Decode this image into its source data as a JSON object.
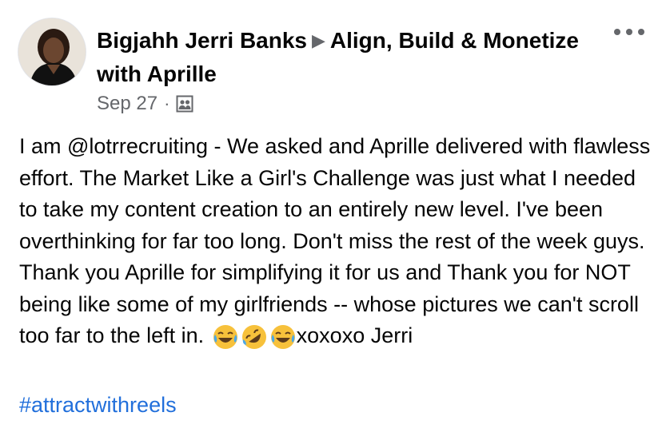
{
  "post": {
    "author": "Bigjahh Jerri Banks",
    "arrow": "▶",
    "group": "Align, Build & Monetize with Aprille",
    "date": "Sep 27",
    "dot": "·",
    "privacy_icon": "group-members-icon",
    "more_icon": "more-options-icon",
    "text_main": "I am @lotrrecruiting - We asked and Aprille delivered with flawless effort. The Market Like a Girl's Challenge was just what I needed to take my content creation to an entirely new level. I've been overthinking for far too long. Don't miss the rest of the week guys. Thank you Aprille for simplifying it for us and Thank you for NOT being like some of my girlfriends -- whose pictures we can't scroll too far to the left in.",
    "emojis": [
      "face-with-tears-of-joy-icon",
      "rolling-on-floor-laughing-icon",
      "face-with-tears-of-joy-icon"
    ],
    "text_tail": "xoxoxo  Jerri",
    "hashtag": "#attractwithreels"
  },
  "colors": {
    "link": "#216fdb",
    "meta": "#65676b",
    "text": "#050505"
  }
}
